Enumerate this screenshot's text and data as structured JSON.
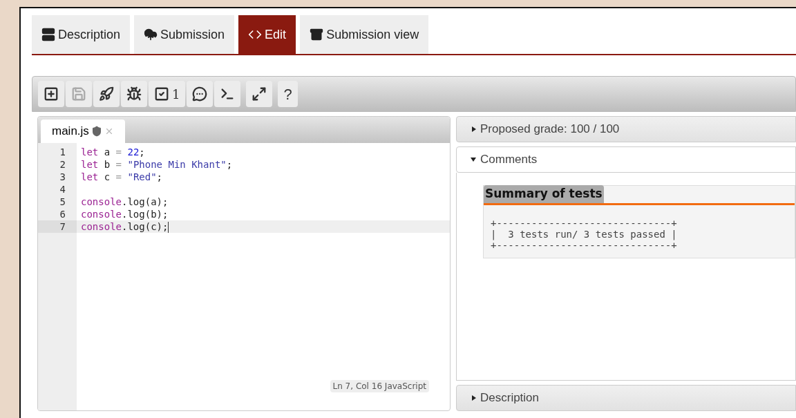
{
  "tabs": [
    {
      "label": "Description",
      "selected": false
    },
    {
      "label": "Submission",
      "selected": false
    },
    {
      "label": "Edit",
      "selected": true
    },
    {
      "label": "Submission view",
      "selected": false
    }
  ],
  "toolbar": [
    {
      "disabled": false
    },
    {
      "disabled": true
    },
    {
      "disabled": false
    },
    {
      "disabled": false
    },
    {
      "disabled": false,
      "count": "1"
    },
    {
      "disabled": false
    },
    {
      "disabled": false
    },
    {
      "disabled": false
    },
    {
      "disabled": false,
      "text": "?"
    }
  ],
  "editor": {
    "file_tab": {
      "label": "main.js",
      "selected": true
    },
    "lines": [
      {
        "number": "1",
        "current": false,
        "tokens": [
          {
            "kind": "keyword",
            "text": "let"
          },
          {
            "kind": "plain",
            "text": " a "
          },
          {
            "kind": "operator",
            "text": "= "
          },
          {
            "kind": "number",
            "text": "22"
          },
          {
            "kind": "plain",
            "text": ";"
          }
        ]
      },
      {
        "number": "2",
        "current": false,
        "tokens": [
          {
            "kind": "keyword",
            "text": "let"
          },
          {
            "kind": "plain",
            "text": " b "
          },
          {
            "kind": "operator",
            "text": "= "
          },
          {
            "kind": "string",
            "text": "\"Phone Min Khant\""
          },
          {
            "kind": "plain",
            "text": ";"
          }
        ]
      },
      {
        "number": "3",
        "current": false,
        "tokens": [
          {
            "kind": "keyword",
            "text": "let"
          },
          {
            "kind": "plain",
            "text": " c "
          },
          {
            "kind": "operator",
            "text": "= "
          },
          {
            "kind": "string",
            "text": "\"Red\""
          },
          {
            "kind": "plain",
            "text": ";"
          }
        ]
      },
      {
        "number": "4",
        "current": false
      },
      {
        "number": "5",
        "current": false,
        "tokens": [
          {
            "kind": "keyword",
            "text": "console"
          },
          {
            "kind": "plain",
            "text": ".log(a);"
          }
        ]
      },
      {
        "number": "6",
        "current": false,
        "tokens": [
          {
            "kind": "keyword",
            "text": "console"
          },
          {
            "kind": "plain",
            "text": ".log(b);"
          }
        ]
      },
      {
        "number": "7",
        "current": true,
        "tokens": [
          {
            "kind": "keyword",
            "text": "console"
          },
          {
            "kind": "plain",
            "text": ".log(c);"
          }
        ]
      }
    ],
    "status": "Ln 7, Col 16 JavaScript"
  },
  "sections": [
    {
      "title": "Proposed grade: 100 / 100",
      "expanded": false
    },
    {
      "title": "Comments",
      "expanded": true,
      "heading": "Summary of tests",
      "report": "+------------------------------+\n|  3 tests run/ 3 tests passed |\n+------------------------------+"
    },
    {
      "title": "Description",
      "expanded": false
    }
  ]
}
